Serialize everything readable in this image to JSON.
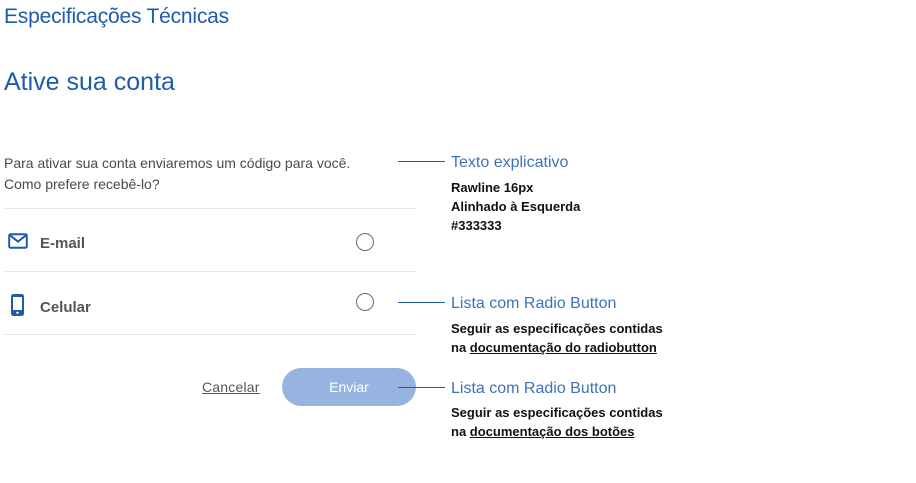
{
  "header": {
    "title": "Especificações Técnicas"
  },
  "form": {
    "title": "Ative sua conta",
    "description_line1": "Para ativar sua conta enviaremos um código para você.",
    "description_line2": "Como prefere recebê-lo?",
    "options": [
      {
        "label": "E-mail",
        "icon": "mail-icon",
        "selected": false
      },
      {
        "label": "Celular",
        "icon": "smartphone-icon",
        "selected": false
      }
    ],
    "cancel_label": "Cancelar",
    "submit_label": "Enviar"
  },
  "annotations": [
    {
      "title": "Texto explicativo",
      "lines": [
        "Rawline 16px",
        "Alinhado à Esquerda",
        "#333333"
      ]
    },
    {
      "title": "Lista com Radio Button",
      "line1": "Seguir as especificações contidas",
      "prefix": "na ",
      "link": "documentação do radiobutton"
    },
    {
      "title": "Lista com Radio Button",
      "line1": "Seguir as especificações contidas",
      "prefix": "na ",
      "link": "documentação dos botões"
    }
  ],
  "colors": {
    "primary": "#1f5bad",
    "annotation": "#3f72bb",
    "text": "#333333",
    "button_disabled": "#97b4e0",
    "divider": "#e6e6e6"
  }
}
